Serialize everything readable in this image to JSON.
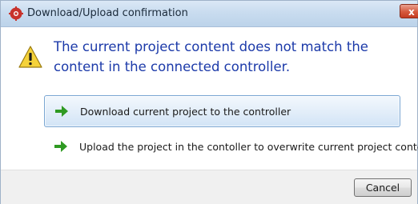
{
  "window": {
    "title": "Download/Upload confirmation",
    "close_label": "x",
    "icons": {
      "app": "app-logo-icon",
      "close": "close-icon",
      "warning": "warning-icon"
    }
  },
  "dialog": {
    "message": "The current project content does not match the content in the connected controller.",
    "options": [
      {
        "label": "Download current project to the controller",
        "icon": "green-arrow-icon",
        "selected": true
      },
      {
        "label": "Upload the project in the contoller to overwrite current project content",
        "icon": "green-arrow-icon",
        "selected": false
      }
    ],
    "cancel_label": "Cancel"
  },
  "colors": {
    "message_text": "#1c3aa9",
    "title_bar": "#c9dcef",
    "selected_option_border": "#7aa6d2",
    "arrow_green": "#2f9a22",
    "close_button": "#d5583c"
  }
}
